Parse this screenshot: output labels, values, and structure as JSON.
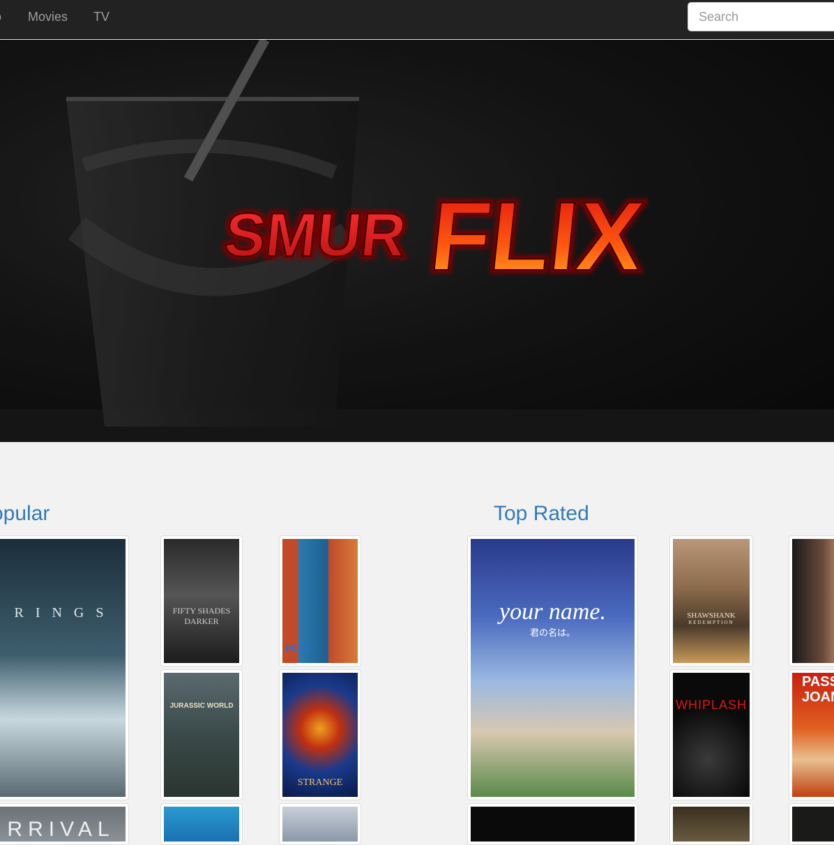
{
  "nav": {
    "brand": "o",
    "items": [
      {
        "label": "Movies"
      },
      {
        "label": "TV"
      }
    ],
    "search_placeholder": "Search"
  },
  "hero": {
    "logo_part1": "SMUR",
    "logo_part2": "FLIX"
  },
  "sections": {
    "popular": {
      "title": "opular",
      "posters": [
        {
          "text": "R I N G S",
          "icon": "rings-poster"
        },
        {
          "text": "FIFTY SHADES DARKER",
          "icon": "fifty-shades-darker-poster"
        },
        {
          "text": "PETS",
          "icon": "pets-poster"
        },
        {
          "text": "JURASSIC WORLD",
          "icon": "jurassic-world-poster"
        },
        {
          "text": "STRANGE",
          "icon": "doctor-strange-poster"
        },
        {
          "text": "RRIVAL",
          "icon": "arrival-poster"
        },
        {
          "text": "",
          "icon": "ocean-poster"
        },
        {
          "text": "",
          "icon": "snow-poster"
        }
      ]
    },
    "top_rated": {
      "title": "Top Rated",
      "posters": [
        {
          "text": "your name.",
          "subtext": "君の名は。",
          "icon": "your-name-poster"
        },
        {
          "text": "SHAWSHANK",
          "subtext": "REDEMPTION",
          "icon": "shawshank-poster"
        },
        {
          "text": "",
          "icon": "godfather-poster"
        },
        {
          "text": "WHIPLASH",
          "icon": "whiplash-poster"
        },
        {
          "text": "PASS",
          "subtext": "JOAN",
          "icon": "passion-joan-poster"
        },
        {
          "text": "",
          "icon": "dark-poster"
        },
        {
          "text": "",
          "icon": "sepia-poster"
        },
        {
          "text": "",
          "icon": "dark-poster-2"
        }
      ]
    }
  }
}
